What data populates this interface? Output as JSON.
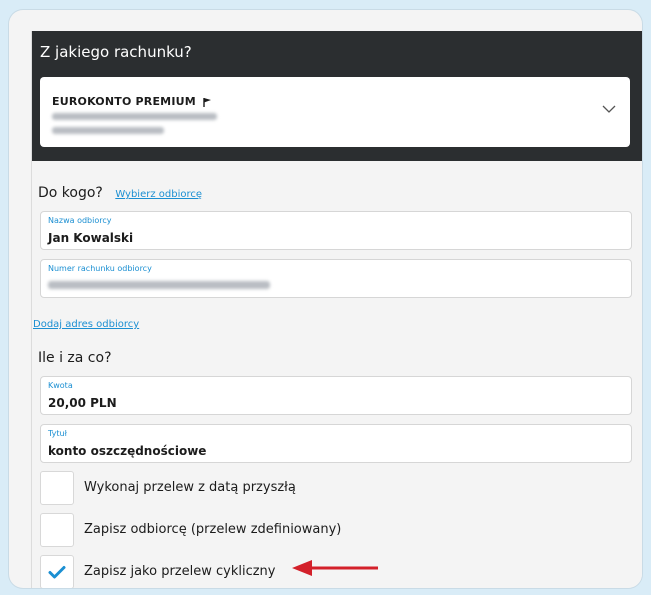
{
  "source_account": {
    "section_title": "Z jakiego rachunku?",
    "account_name": "EUROKONTO PREMIUM"
  },
  "recipient": {
    "section_title": "Do kogo?",
    "choose_recipient_link": "Wybierz odbiorcę",
    "name_label": "Nazwa odbiorcy",
    "name_value": "Jan Kowalski",
    "account_number_label": "Numer rachunku odbiorcy",
    "add_address_link": "Dodaj adres odbiorcy"
  },
  "payment": {
    "section_title": "Ile i za co?",
    "amount_label": "Kwota",
    "amount_value": "20,00 PLN",
    "title_label": "Tytuł",
    "title_value": "konto oszczędnościowe"
  },
  "options": [
    {
      "label": "Wykonaj przelew z datą przyszłą",
      "checked": false
    },
    {
      "label": "Zapisz odbiorcę (przelew zdefiniowany)",
      "checked": false
    },
    {
      "label": "Zapisz jako przelew cykliczny",
      "checked": true
    }
  ],
  "colors": {
    "accent": "#1b8fd2",
    "header_bg": "#2b2e30",
    "arrow": "#d3202a"
  }
}
